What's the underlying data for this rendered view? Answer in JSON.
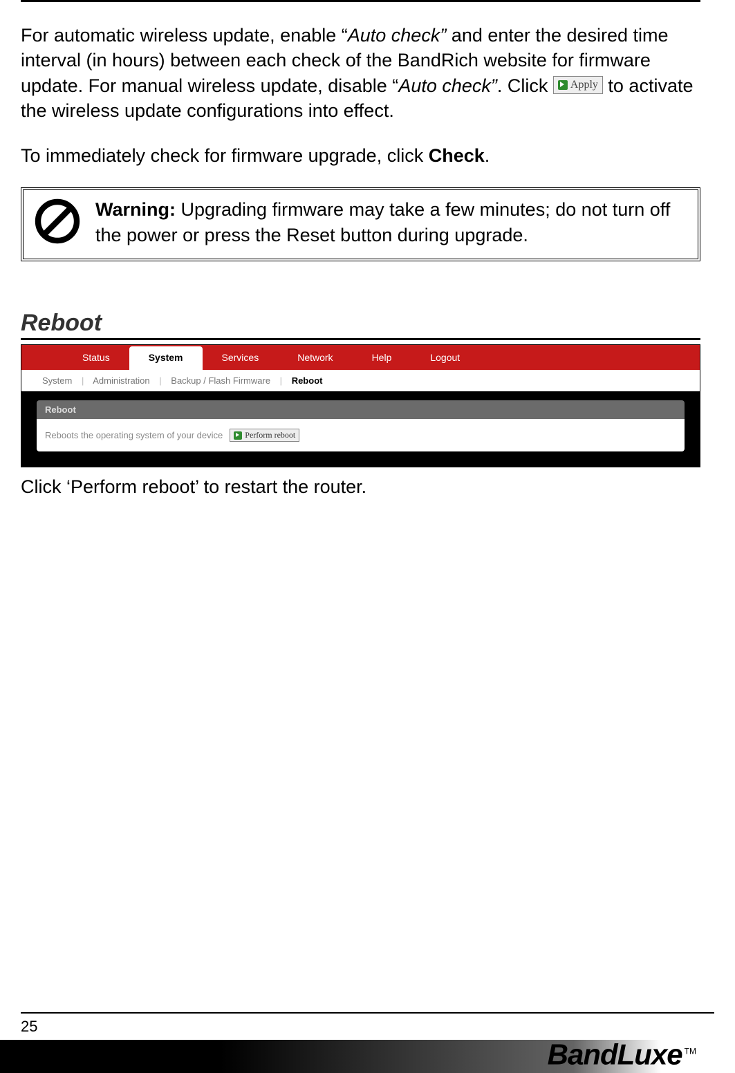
{
  "para1": {
    "pre": "For automatic wireless update, enable “",
    "em1": "Auto check” ",
    "mid1": "and enter the desired time interval (in hours) between each check of the BandRich website for firmware update. For manual wireless update, disable “",
    "em2": "Auto check”",
    "mid2": ". Click ",
    "apply_label": "Apply",
    "post": " to activate the wireless update configurations into effect."
  },
  "para2": {
    "pre": "To immediately check for firmware upgrade, click ",
    "strong": "Check",
    "post": "."
  },
  "warning": {
    "label": "Warning:",
    "text": " Upgrading firmware may take a few minutes; do not turn off the power or press the Reset button during upgrade."
  },
  "section_heading": "Reboot",
  "router": {
    "topnav": {
      "status": "Status",
      "system": "System",
      "services": "Services",
      "network": "Network",
      "help": "Help",
      "logout": "Logout"
    },
    "subnav": {
      "system": "System",
      "administration": "Administration",
      "backup": "Backup / Flash Firmware",
      "reboot": "Reboot"
    },
    "panel_title": "Reboot",
    "panel_desc": "Reboots the operating system of your device",
    "perform_label": "Perform reboot"
  },
  "caption": "Click ‘Perform reboot’ to restart the router.",
  "page_number": "25",
  "brand": "BandLuxe",
  "brand_tm": "TM"
}
